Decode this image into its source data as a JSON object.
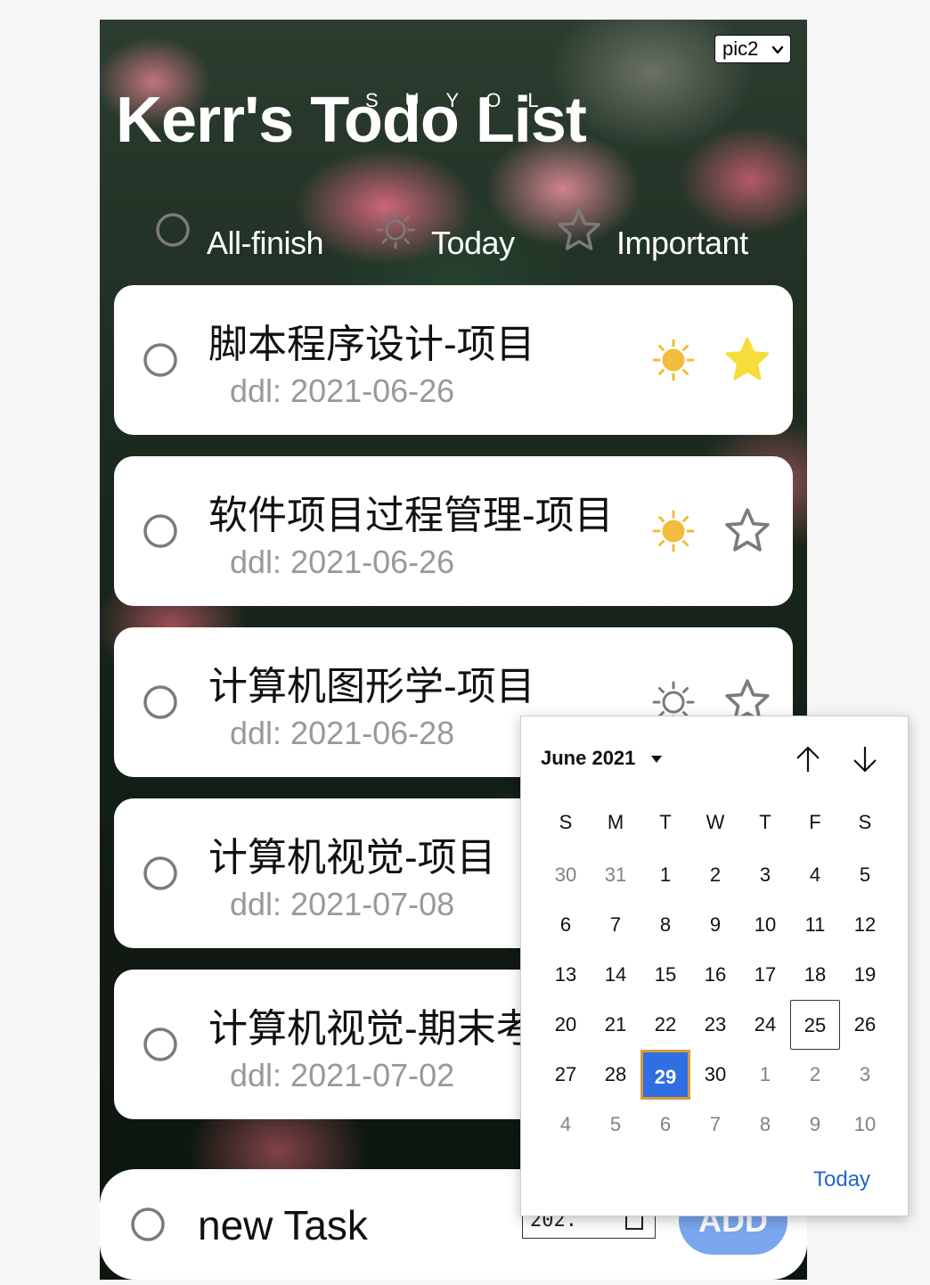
{
  "header": {
    "title": "Kerr's Todo List",
    "watermark": "SUYOL",
    "background_select": {
      "value": "pic2"
    }
  },
  "filters": [
    {
      "label": "All-finish",
      "icon": "circle-icon"
    },
    {
      "label": "Today",
      "icon": "sun-icon"
    },
    {
      "label": "Important",
      "icon": "star-icon"
    }
  ],
  "tasks": [
    {
      "name": "脚本程序设计-项目",
      "ddl": "ddl: 2021-06-26",
      "today": true,
      "important": true
    },
    {
      "name": "软件项目过程管理-项目",
      "ddl": "ddl: 2021-06-26",
      "today": true,
      "important": false
    },
    {
      "name": "计算机图形学-项目",
      "ddl": "ddl: 2021-06-28",
      "today": false,
      "important": false
    },
    {
      "name": "计算机视觉-项目",
      "ddl": "ddl: 2021-07-08",
      "today": false,
      "important": false
    },
    {
      "name": "计算机视觉-期末考",
      "ddl": "ddl: 2021-07-02",
      "today": false,
      "important": false
    }
  ],
  "new_task": {
    "value": "new Task",
    "date_value": "202.",
    "add_label": "ADD"
  },
  "date_picker": {
    "month_label": "June 2021",
    "weekdays": [
      "S",
      "M",
      "T",
      "W",
      "T",
      "F",
      "S"
    ],
    "weeks": [
      [
        "30",
        "31",
        "1",
        "2",
        "3",
        "4",
        "5"
      ],
      [
        "6",
        "7",
        "8",
        "9",
        "10",
        "11",
        "12"
      ],
      [
        "13",
        "14",
        "15",
        "16",
        "17",
        "18",
        "19"
      ],
      [
        "20",
        "21",
        "22",
        "23",
        "24",
        "25",
        "26"
      ],
      [
        "27",
        "28",
        "29",
        "30",
        "1",
        "2",
        "3"
      ],
      [
        "4",
        "5",
        "6",
        "7",
        "8",
        "9",
        "10"
      ]
    ],
    "current_day": "25",
    "selected_day": "29",
    "today_label": "Today"
  },
  "colors": {
    "sun": "#f2bc3c",
    "star_filled": "#f7dd3a",
    "icon_outline": "#7b7b7b",
    "selected_day": "#2f6fe3",
    "add_button": "#7aa7ee",
    "today_link": "#1f66d1"
  }
}
